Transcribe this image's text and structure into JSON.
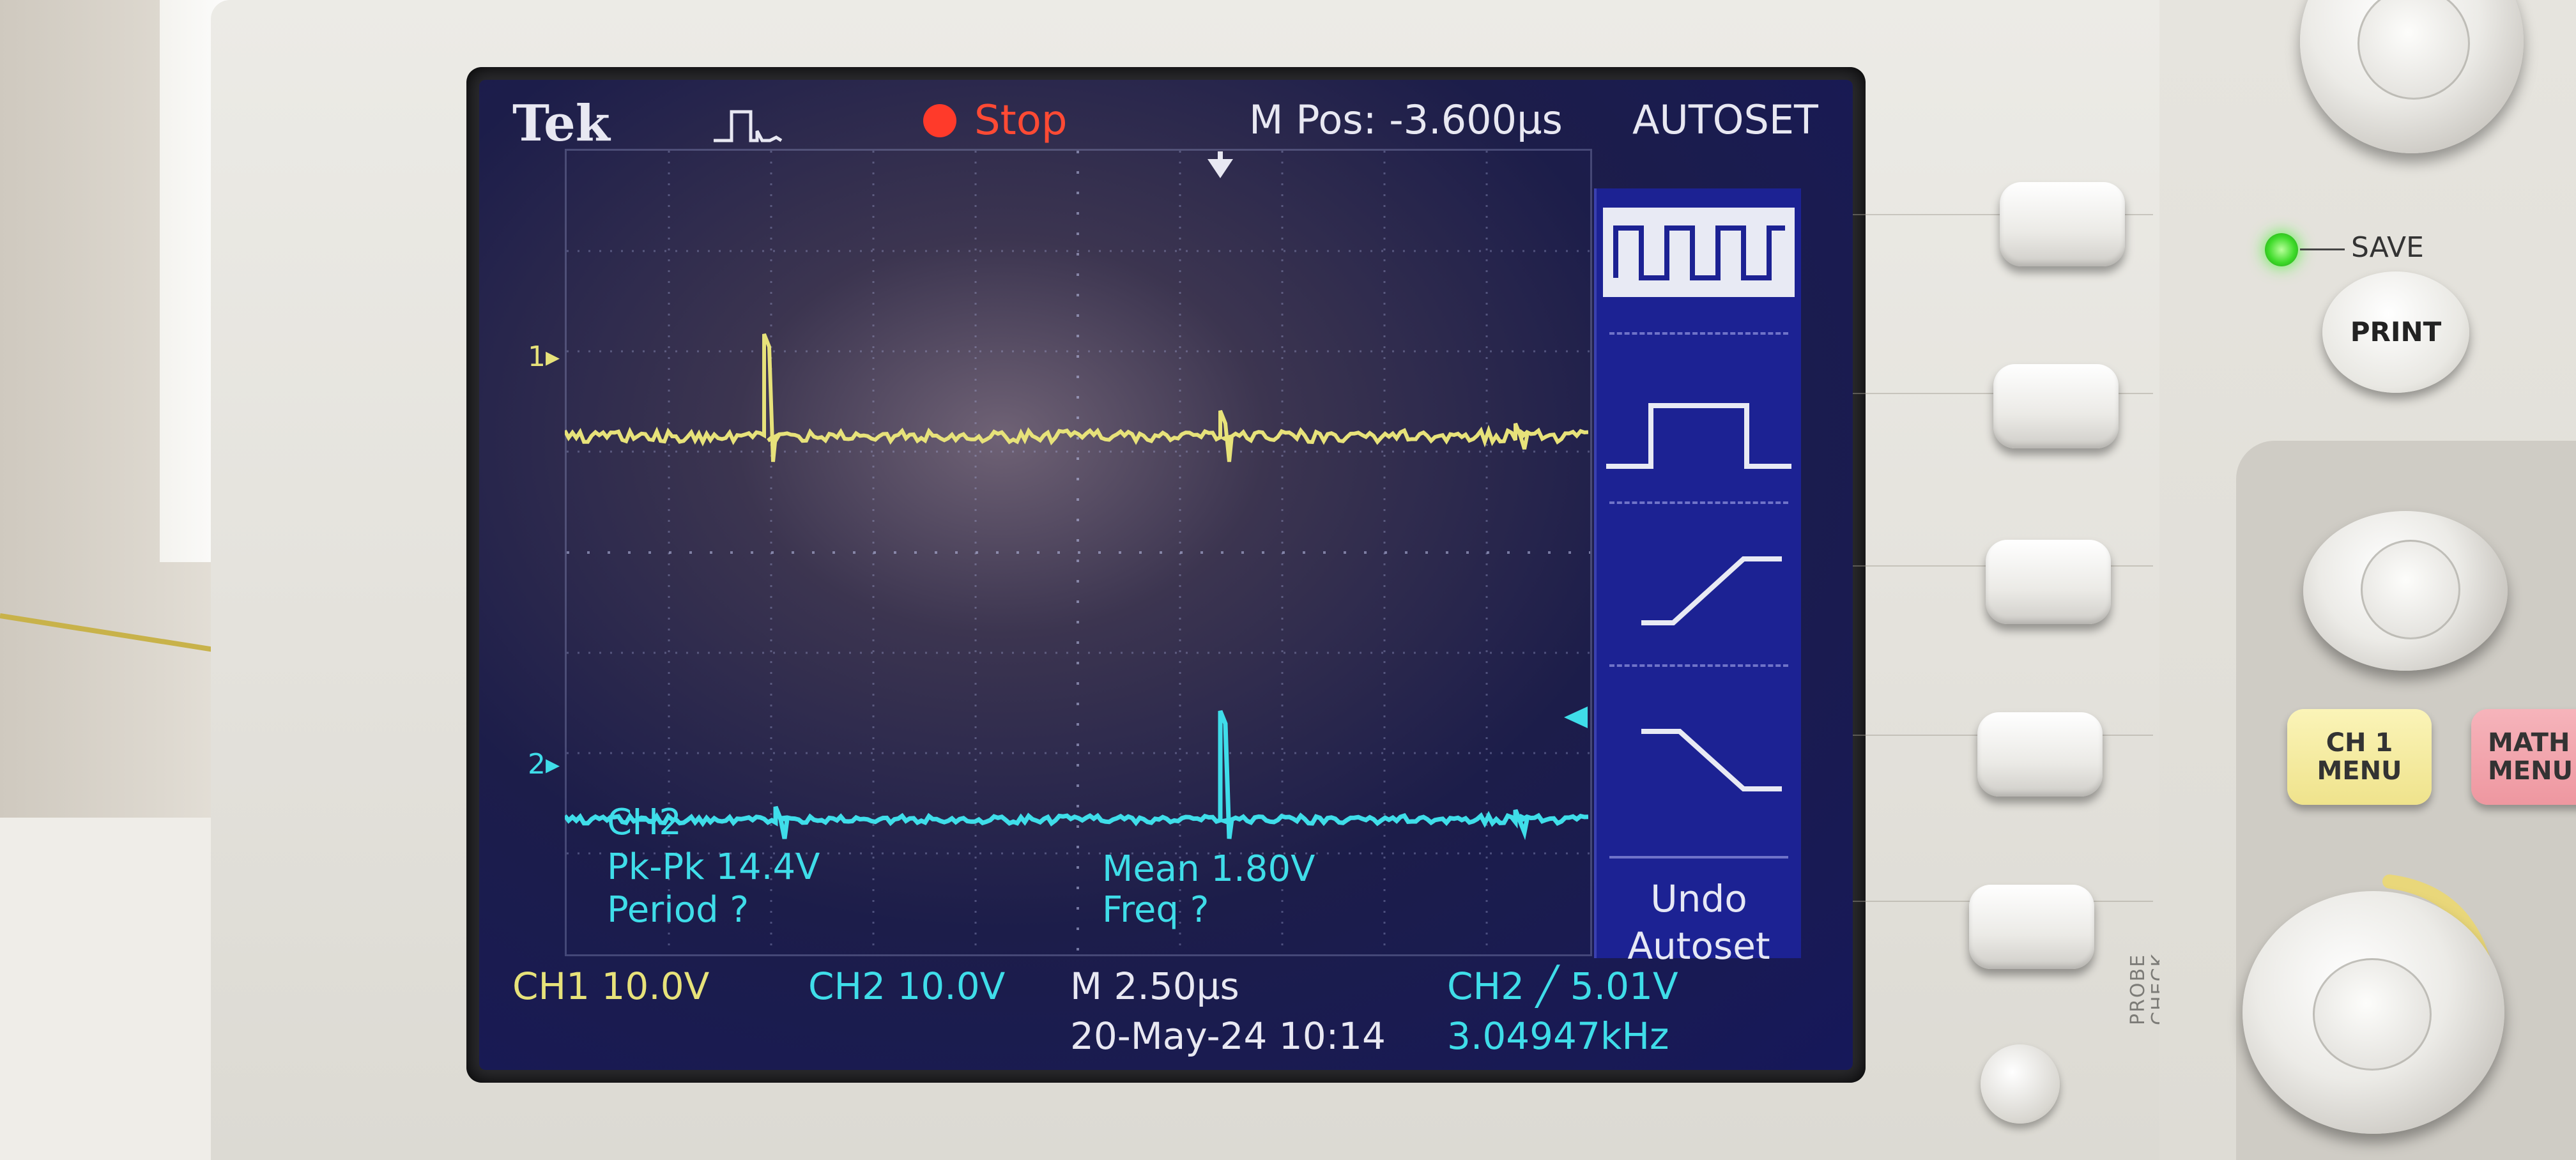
{
  "screen": {
    "brand": "Tek",
    "run_state": "Stop",
    "horizontal_position": "M Pos: -3.600µs",
    "menu_title": "AUTOSET",
    "channel_markers": {
      "ch1": "1▸",
      "ch2": "2▸"
    },
    "measurements": {
      "source": "CH2",
      "pk_pk": "Pk-Pk 14.4V",
      "period": "Period ?",
      "mean": "Mean 1.80V",
      "freq": "Freq ?"
    },
    "autoset_menu": {
      "options": [
        {
          "icon": "multi-cycle-square-wave-icon",
          "selected": true
        },
        {
          "icon": "single-cycle-pulse-icon",
          "selected": false
        },
        {
          "icon": "rising-edge-icon",
          "selected": false
        },
        {
          "icon": "falling-edge-icon",
          "selected": false
        }
      ],
      "undo_label_line1": "Undo",
      "undo_label_line2": "Autoset"
    },
    "status": {
      "ch1_scale": "CH1  10.0V",
      "ch2_scale": "CH2  10.0V",
      "timebase": "M 2.50µs",
      "trigger": "CH2 ╱ 5.01V",
      "datetime": "20-May-24 10:14",
      "trigger_frequency": "3.04947kHz"
    },
    "trace_colors": {
      "ch1": "#e7e27a",
      "ch2": "#3fdde9"
    }
  },
  "controls": {
    "save_label": "SAVE",
    "print_label": "PRINT",
    "ch1_menu_label": "CH 1\nMENU",
    "math_menu_label": "MATH\nMENU",
    "probe_check_label": "PROBE\nCHECK"
  }
}
